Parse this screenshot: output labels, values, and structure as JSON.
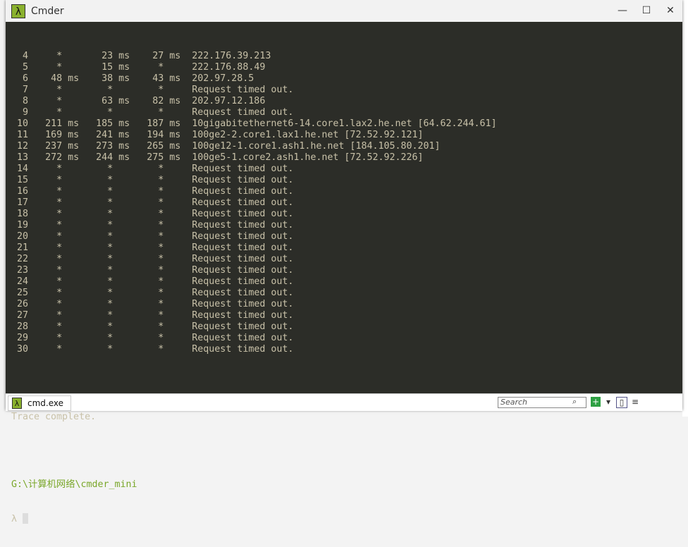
{
  "window": {
    "title": "Cmder",
    "logo": "λ",
    "minimize": "—",
    "maximize": "☐",
    "close": "✕"
  },
  "terminal": {
    "rows": [
      {
        "hop": "4",
        "t1": "*",
        "t2": "23 ms",
        "t3": "27 ms",
        "host": "222.176.39.213"
      },
      {
        "hop": "5",
        "t1": "*",
        "t2": "15 ms",
        "t3": "*",
        "host": "222.176.88.49"
      },
      {
        "hop": "6",
        "t1": "48 ms",
        "t2": "38 ms",
        "t3": "43 ms",
        "host": "202.97.28.5"
      },
      {
        "hop": "7",
        "t1": "*",
        "t2": "*",
        "t3": "*",
        "host": "Request timed out."
      },
      {
        "hop": "8",
        "t1": "*",
        "t2": "63 ms",
        "t3": "82 ms",
        "host": "202.97.12.186"
      },
      {
        "hop": "9",
        "t1": "*",
        "t2": "*",
        "t3": "*",
        "host": "Request timed out."
      },
      {
        "hop": "10",
        "t1": "211 ms",
        "t2": "185 ms",
        "t3": "187 ms",
        "host": "10gigabitethernet6-14.core1.lax2.he.net [64.62.244.61]"
      },
      {
        "hop": "11",
        "t1": "169 ms",
        "t2": "241 ms",
        "t3": "194 ms",
        "host": "100ge2-2.core1.lax1.he.net [72.52.92.121]"
      },
      {
        "hop": "12",
        "t1": "237 ms",
        "t2": "273 ms",
        "t3": "265 ms",
        "host": "100ge12-1.core1.ash1.he.net [184.105.80.201]"
      },
      {
        "hop": "13",
        "t1": "272 ms",
        "t2": "244 ms",
        "t3": "275 ms",
        "host": "100ge5-1.core2.ash1.he.net [72.52.92.226]"
      },
      {
        "hop": "14",
        "t1": "*",
        "t2": "*",
        "t3": "*",
        "host": "Request timed out."
      },
      {
        "hop": "15",
        "t1": "*",
        "t2": "*",
        "t3": "*",
        "host": "Request timed out."
      },
      {
        "hop": "16",
        "t1": "*",
        "t2": "*",
        "t3": "*",
        "host": "Request timed out."
      },
      {
        "hop": "17",
        "t1": "*",
        "t2": "*",
        "t3": "*",
        "host": "Request timed out."
      },
      {
        "hop": "18",
        "t1": "*",
        "t2": "*",
        "t3": "*",
        "host": "Request timed out."
      },
      {
        "hop": "19",
        "t1": "*",
        "t2": "*",
        "t3": "*",
        "host": "Request timed out."
      },
      {
        "hop": "20",
        "t1": "*",
        "t2": "*",
        "t3": "*",
        "host": "Request timed out."
      },
      {
        "hop": "21",
        "t1": "*",
        "t2": "*",
        "t3": "*",
        "host": "Request timed out."
      },
      {
        "hop": "22",
        "t1": "*",
        "t2": "*",
        "t3": "*",
        "host": "Request timed out."
      },
      {
        "hop": "23",
        "t1": "*",
        "t2": "*",
        "t3": "*",
        "host": "Request timed out."
      },
      {
        "hop": "24",
        "t1": "*",
        "t2": "*",
        "t3": "*",
        "host": "Request timed out."
      },
      {
        "hop": "25",
        "t1": "*",
        "t2": "*",
        "t3": "*",
        "host": "Request timed out."
      },
      {
        "hop": "26",
        "t1": "*",
        "t2": "*",
        "t3": "*",
        "host": "Request timed out."
      },
      {
        "hop": "27",
        "t1": "*",
        "t2": "*",
        "t3": "*",
        "host": "Request timed out."
      },
      {
        "hop": "28",
        "t1": "*",
        "t2": "*",
        "t3": "*",
        "host": "Request timed out."
      },
      {
        "hop": "29",
        "t1": "*",
        "t2": "*",
        "t3": "*",
        "host": "Request timed out."
      },
      {
        "hop": "30",
        "t1": "*",
        "t2": "*",
        "t3": "*",
        "host": "Request timed out."
      }
    ],
    "trace_complete": "Trace complete.",
    "prompt_path": "G:\\计算机网络\\cmder_mini",
    "prompt_symbol": "λ"
  },
  "statusbar": {
    "tab_label": "cmd.exe",
    "tab_icon": "λ",
    "search_placeholder": "Search",
    "search_icon": "⌕"
  }
}
